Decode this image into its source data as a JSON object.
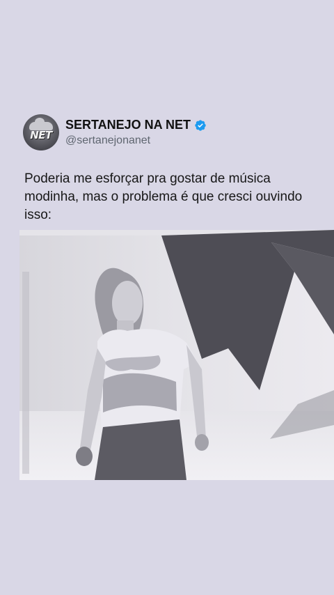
{
  "post": {
    "author": {
      "display_name": "SERTANEJO NA NET",
      "handle": "@sertanejonanet",
      "verified": true,
      "avatar_text": "NET"
    },
    "text": "Poderia me esforçar pra gostar de música modinha, mas o problema é que cresci ouvindo isso:",
    "media": {
      "type": "video-still",
      "description_icon": "media-frame"
    }
  },
  "colors": {
    "background": "#d9d7e6",
    "verified": "#1d9bf0",
    "handle": "#5f6670",
    "text": "#171717"
  }
}
